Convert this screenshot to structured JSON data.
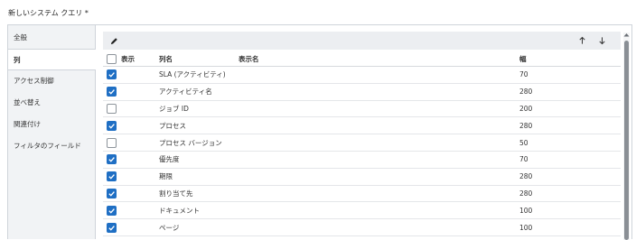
{
  "dialog": {
    "title": "新しいシステム クエリ *"
  },
  "sidebar": {
    "items": [
      {
        "label": "全般",
        "active": false
      },
      {
        "label": "列",
        "active": true
      },
      {
        "label": "アクセス制御",
        "active": false
      },
      {
        "label": "並べ替え",
        "active": false
      },
      {
        "label": "関連付け",
        "active": false
      },
      {
        "label": "フィルタのフィールド",
        "active": false
      }
    ]
  },
  "toolbar": {
    "edit_icon": "pencil-icon",
    "up_icon": "arrow-up-icon",
    "down_icon": "arrow-down-icon"
  },
  "table": {
    "headers": {
      "show": "表示",
      "name": "列名",
      "display_name": "表示名",
      "width": "幅"
    },
    "select_all_checked": false,
    "rows": [
      {
        "checked": true,
        "name": "SLA (アクティビティ)",
        "display_name": "",
        "width": "70"
      },
      {
        "checked": true,
        "name": "アクティビティ名",
        "display_name": "",
        "width": "280"
      },
      {
        "checked": false,
        "name": "ジョブ ID",
        "display_name": "",
        "width": "200"
      },
      {
        "checked": true,
        "name": "プロセス",
        "display_name": "",
        "width": "280"
      },
      {
        "checked": false,
        "name": "プロセス バージョン",
        "display_name": "",
        "width": "50"
      },
      {
        "checked": true,
        "name": "優先度",
        "display_name": "",
        "width": "70"
      },
      {
        "checked": true,
        "name": "期限",
        "display_name": "",
        "width": "280"
      },
      {
        "checked": true,
        "name": "割り当て先",
        "display_name": "",
        "width": "280"
      },
      {
        "checked": true,
        "name": "ドキュメント",
        "display_name": "",
        "width": "100"
      },
      {
        "checked": true,
        "name": "ページ",
        "display_name": "",
        "width": "100"
      }
    ]
  },
  "colors": {
    "accent": "#1f6fc4",
    "sidebar_bg": "#f1f3f5",
    "toolbar_bg": "#eceef1"
  }
}
